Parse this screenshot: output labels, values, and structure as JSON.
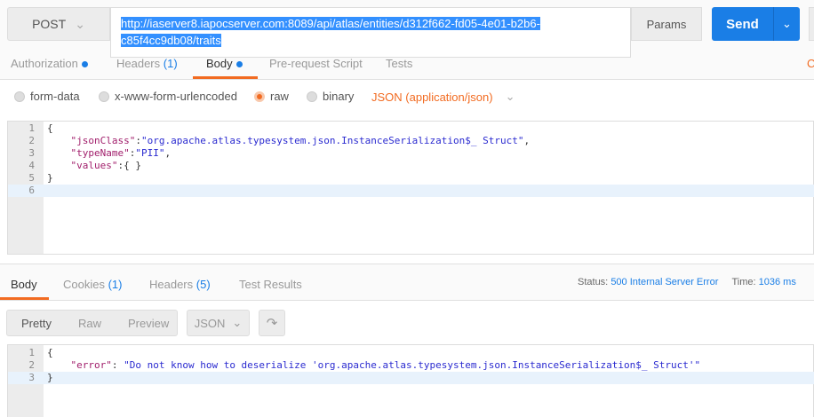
{
  "request": {
    "method": "POST",
    "url": "http://iaserver8.iapocserver.com:8089/api/atlas/entities/d312f662-fd05-4e01-b2b6-c85f4cc9db08/traits",
    "params_label": "Params",
    "send_label": "Send"
  },
  "request_tabs": [
    {
      "label": "Authorization"
    },
    {
      "label": "Headers",
      "count": "(1)"
    },
    {
      "label": "Body"
    },
    {
      "label": "Pre-request Script"
    },
    {
      "label": "Tests"
    }
  ],
  "cut_label": "C",
  "body_types": [
    "form-data",
    "x-www-form-urlencoded",
    "raw",
    "binary"
  ],
  "content_type": "JSON (application/json)",
  "request_body": {
    "line1": "{",
    "l2k": "\"jsonClass\"",
    "l2v": "\"org.apache.atlas.typesystem.json.InstanceSerialization$_ Struct\"",
    "l3k": "\"typeName\"",
    "l3v": "\"PII\"",
    "l4k": "\"values\"",
    "l4v": "{ }",
    "line5": "}",
    "nums": [
      "1",
      "2",
      "3",
      "4",
      "5",
      "6"
    ]
  },
  "response_tabs": [
    {
      "label": "Body"
    },
    {
      "label": "Cookies",
      "count": "(1)"
    },
    {
      "label": "Headers",
      "count": "(5)"
    },
    {
      "label": "Test Results"
    }
  ],
  "status": {
    "label": "Status:",
    "value": "500 Internal Server Error",
    "time_label": "Time:",
    "time_value": "1036 ms"
  },
  "view_modes": [
    "Pretty",
    "Raw",
    "Preview"
  ],
  "format": "JSON",
  "response_body": {
    "line1": "{",
    "l2k": "\"error\"",
    "l2v": "\"Do not know how to deserialize 'org.apache.atlas.typesystem.json.InstanceSerialization$_ Struct'\"",
    "line3": "}",
    "nums": [
      "1",
      "2",
      "3"
    ]
  },
  "colors": {
    "accent": "#f26b21",
    "primary": "#1a7ee6"
  }
}
